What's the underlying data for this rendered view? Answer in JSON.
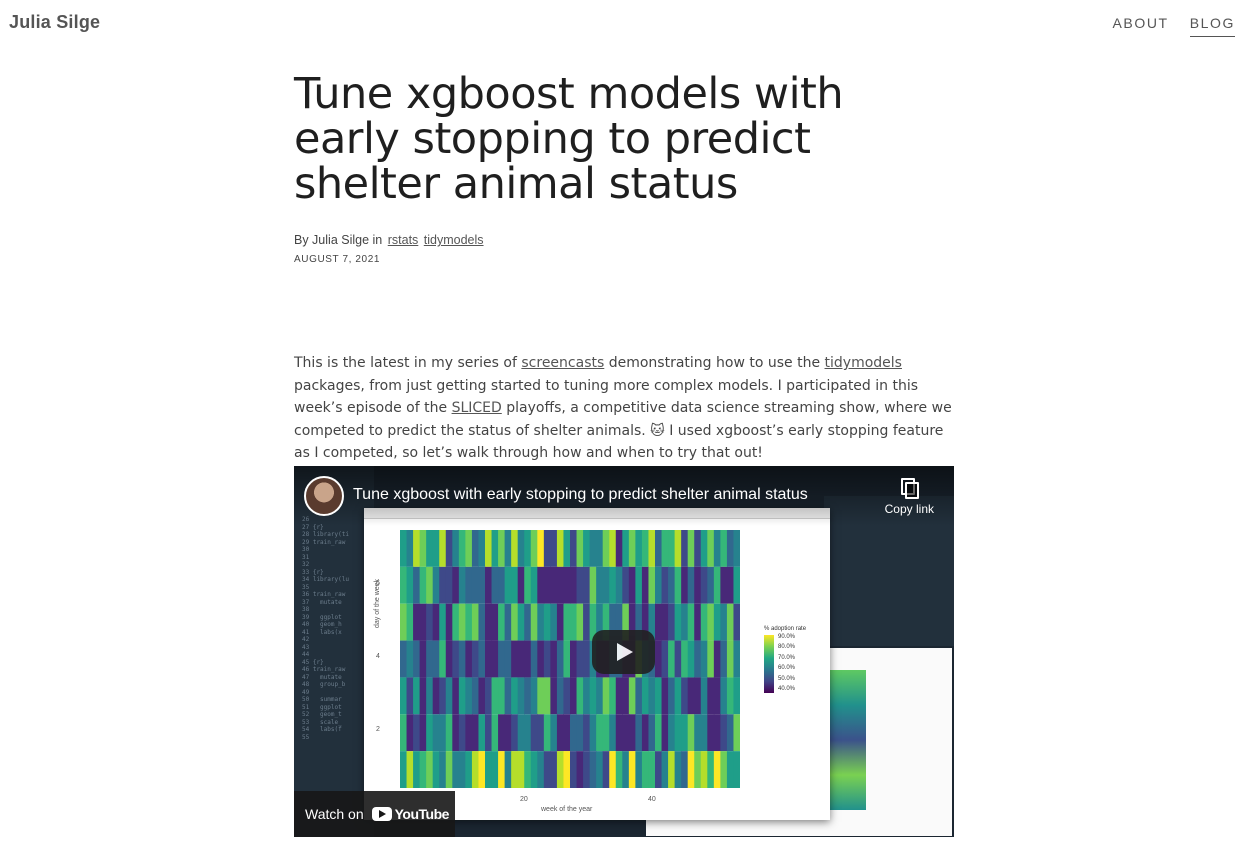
{
  "site": {
    "title": "Julia Silge"
  },
  "nav": {
    "items": [
      {
        "label": "ABOUT"
      },
      {
        "label": "BLOG"
      }
    ]
  },
  "article": {
    "title": "Tune xgboost models with early stopping to predict shelter animal status",
    "byline_prefix": "By Julia Silge in",
    "tags": [
      "rstats",
      "tidymodels"
    ],
    "date": "AUGUST 7, 2021",
    "intro": {
      "t1": "This is the latest in my series of ",
      "link1": "screencasts",
      "t2": " demonstrating how to use the ",
      "link2": "tidymodels",
      "t3": " packages, from just getting started to tuning more complex models. I participated in this week’s episode of the ",
      "link3": "SLICED",
      "t4": " playoffs, a competitive data science streaming show, where we competed to predict the status of shelter animals. 🐱 I used xgboost’s early stopping feature as I competed, so let’s walk through how and when to try that out!"
    }
  },
  "video": {
    "title": "Tune xgboost with early stopping to predict shelter animal status",
    "copy_link": "Copy link",
    "watch_on": "Watch on",
    "youtube": "YouTube",
    "plot": {
      "ylabel": "day of the week",
      "xlabel": "week of the year",
      "legend_title": "% adoption rate",
      "legend_ticks": [
        "90.0%",
        "80.0%",
        "70.0%",
        "60.0%",
        "50.0%",
        "40.0%"
      ],
      "x_ticks": [
        "20",
        "40"
      ],
      "y_ticks": [
        "6",
        "4",
        "2"
      ]
    }
  }
}
